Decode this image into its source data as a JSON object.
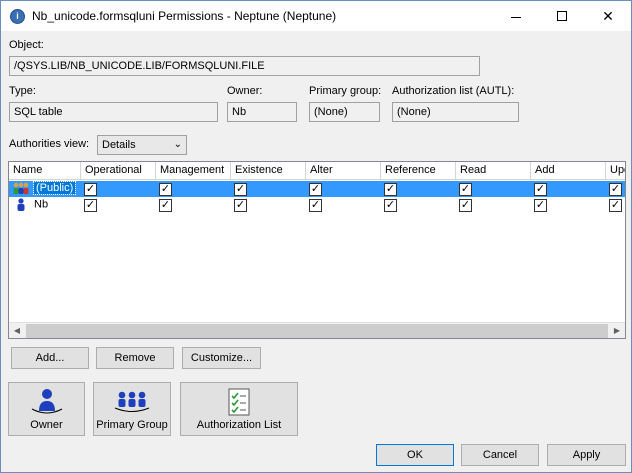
{
  "window": {
    "title": "Nb_unicode.formsqluni Permissions - Neptune (Neptune)"
  },
  "object": {
    "label": "Object:",
    "value": "/QSYS.LIB/NB_UNICODE.LIB/FORMSQLUNI.FILE"
  },
  "type": {
    "label": "Type:",
    "value": "SQL table"
  },
  "owner": {
    "label": "Owner:",
    "value": "Nb"
  },
  "primary_group": {
    "label": "Primary group:",
    "value": "(None)"
  },
  "autl": {
    "label": "Authorization list (AUTL):",
    "value": "(None)"
  },
  "authorities_view": {
    "label": "Authorities view:",
    "selected": "Details"
  },
  "table": {
    "columns": [
      "Name",
      "Operational",
      "Management",
      "Existence",
      "Alter",
      "Reference",
      "Read",
      "Add",
      "Upd"
    ],
    "rows": [
      {
        "name": "(Public)",
        "selected": true,
        "checks": [
          true,
          true,
          true,
          true,
          true,
          true,
          true,
          true
        ]
      },
      {
        "name": "Nb",
        "selected": false,
        "checks": [
          true,
          true,
          true,
          true,
          true,
          true,
          true,
          true
        ]
      }
    ]
  },
  "buttons": {
    "add": "Add...",
    "remove": "Remove",
    "customize": "Customize...",
    "owner": "Owner",
    "primary_group": "Primary Group",
    "authorization_list": "Authorization List",
    "ok": "OK",
    "cancel": "Cancel",
    "apply": "Apply"
  },
  "colors": {
    "selection": "#3399ff",
    "icon_blue": "#1f3fbf"
  }
}
